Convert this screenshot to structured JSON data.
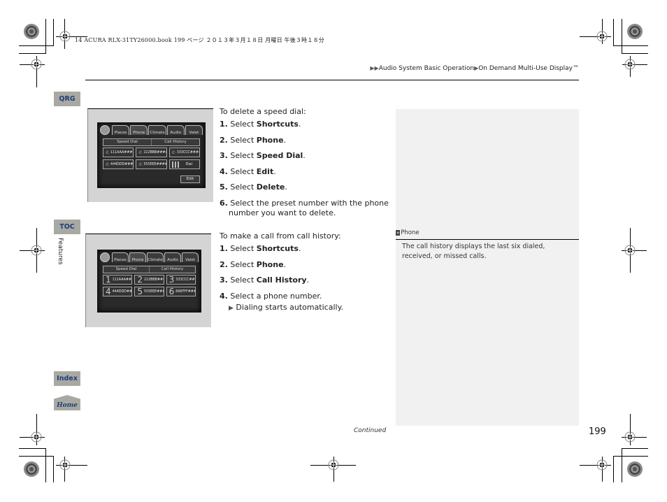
{
  "print_header": "14 ACURA RLX-31TY26000.book  199 ページ  ２０１３年３月１８日  月曜日  午後３時１８分",
  "breadcrumb": {
    "prefix_icon": "double-arrow-right",
    "section": "Audio System Basic Operation",
    "separator_icon": "arrow-right",
    "page": "On Demand Multi-Use Display™"
  },
  "side_nav": {
    "qrg": "QRG",
    "toc": "TOC",
    "chapter": "Features",
    "index": "Index",
    "home": "Home"
  },
  "screens": {
    "tabs": [
      "Places",
      "Phone",
      "Climate",
      "Audio",
      "Valet"
    ],
    "segment": [
      "Speed Dial",
      "Call History"
    ],
    "speed_dial": {
      "cells": [
        "111AAA####",
        "222BBB####",
        "333CCC####",
        "444DDD####",
        "555EEE####",
        "Dial"
      ],
      "edit": "Edit"
    },
    "call_history": {
      "cells": [
        {
          "num": "1",
          "label": "111AAA####"
        },
        {
          "num": "2",
          "label": "222BBB####"
        },
        {
          "num": "3",
          "label": "333CCC####"
        },
        {
          "num": "4",
          "label": "444DDD####"
        },
        {
          "num": "5",
          "label": "555EEE####"
        },
        {
          "num": "6",
          "label": "666FFF####"
        }
      ]
    }
  },
  "delete_speed_dial": {
    "intro": "To delete a speed dial:",
    "steps": [
      {
        "n": "1.",
        "text": "Select ",
        "bold": "Shortcuts",
        "end": "."
      },
      {
        "n": "2.",
        "text": "Select ",
        "bold": "Phone",
        "end": "."
      },
      {
        "n": "3.",
        "text": "Select ",
        "bold": "Speed Dial",
        "end": "."
      },
      {
        "n": "4.",
        "text": "Select ",
        "bold": "Edit",
        "end": "."
      },
      {
        "n": "5.",
        "text": "Select ",
        "bold": "Delete",
        "end": "."
      },
      {
        "n": "6.",
        "text": "Select the preset number with the phone number you want to delete.",
        "bold": "",
        "end": ""
      }
    ]
  },
  "call_from_history": {
    "intro": "To make a call from call history:",
    "steps": [
      {
        "n": "1.",
        "text": "Select ",
        "bold": "Shortcuts",
        "end": "."
      },
      {
        "n": "2.",
        "text": "Select ",
        "bold": "Phone",
        "end": "."
      },
      {
        "n": "3.",
        "text": "Select ",
        "bold": "Call History",
        "end": "."
      },
      {
        "n": "4.",
        "text": "Select a phone number.",
        "bold": "",
        "end": ""
      }
    ],
    "result": "Dialing starts automatically."
  },
  "note": {
    "icon": "double-chevron",
    "title": "Phone",
    "body": "The call history displays the last six dialed, received, or missed calls."
  },
  "footer": {
    "continued": "Continued",
    "page_number": "199"
  }
}
